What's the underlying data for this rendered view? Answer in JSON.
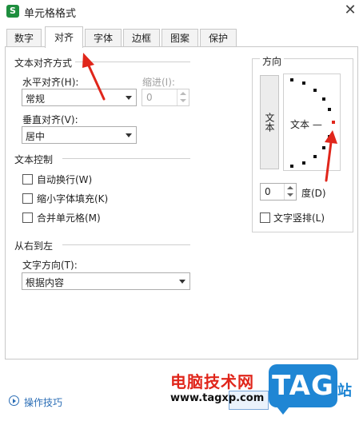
{
  "window": {
    "title": "单元格格式",
    "app_icon_glyph": "S",
    "close_glyph": "✕"
  },
  "tabs": [
    {
      "label": "数字",
      "active": false
    },
    {
      "label": "对齐",
      "active": true
    },
    {
      "label": "字体",
      "active": false
    },
    {
      "label": "边框",
      "active": false
    },
    {
      "label": "图案",
      "active": false
    },
    {
      "label": "保护",
      "active": false
    }
  ],
  "text_alignment": {
    "section_title": "文本对齐方式",
    "horizontal_label": "水平对齐(H):",
    "horizontal_value": "常规",
    "indent_label": "缩进(I):",
    "indent_value": "0",
    "vertical_label": "垂直对齐(V):",
    "vertical_value": "居中"
  },
  "text_control": {
    "section_title": "文本控制",
    "wrap_label": "自动换行(W)",
    "shrink_label": "缩小字体填充(K)",
    "merge_label": "合并单元格(M)"
  },
  "rtl": {
    "section_title": "从右到左",
    "direction_label": "文字方向(T):",
    "direction_value": "根据内容"
  },
  "orientation": {
    "section_title": "方向",
    "vertical_text_button": "文本",
    "dial_text": "文本 —",
    "degree_value": "0",
    "degree_label": "度(D)",
    "vertical_text_label": "文字竖排(L)"
  },
  "footer": {
    "tips_label": "操作技巧"
  },
  "watermark": {
    "text": "电脑技术网",
    "url": "www.tagxp.com",
    "logo": "TAG",
    "side": "站"
  },
  "colors": {
    "accent_red": "#e0261b",
    "watermark_blue": "#1f86d4",
    "link_blue": "#2a6db5"
  }
}
